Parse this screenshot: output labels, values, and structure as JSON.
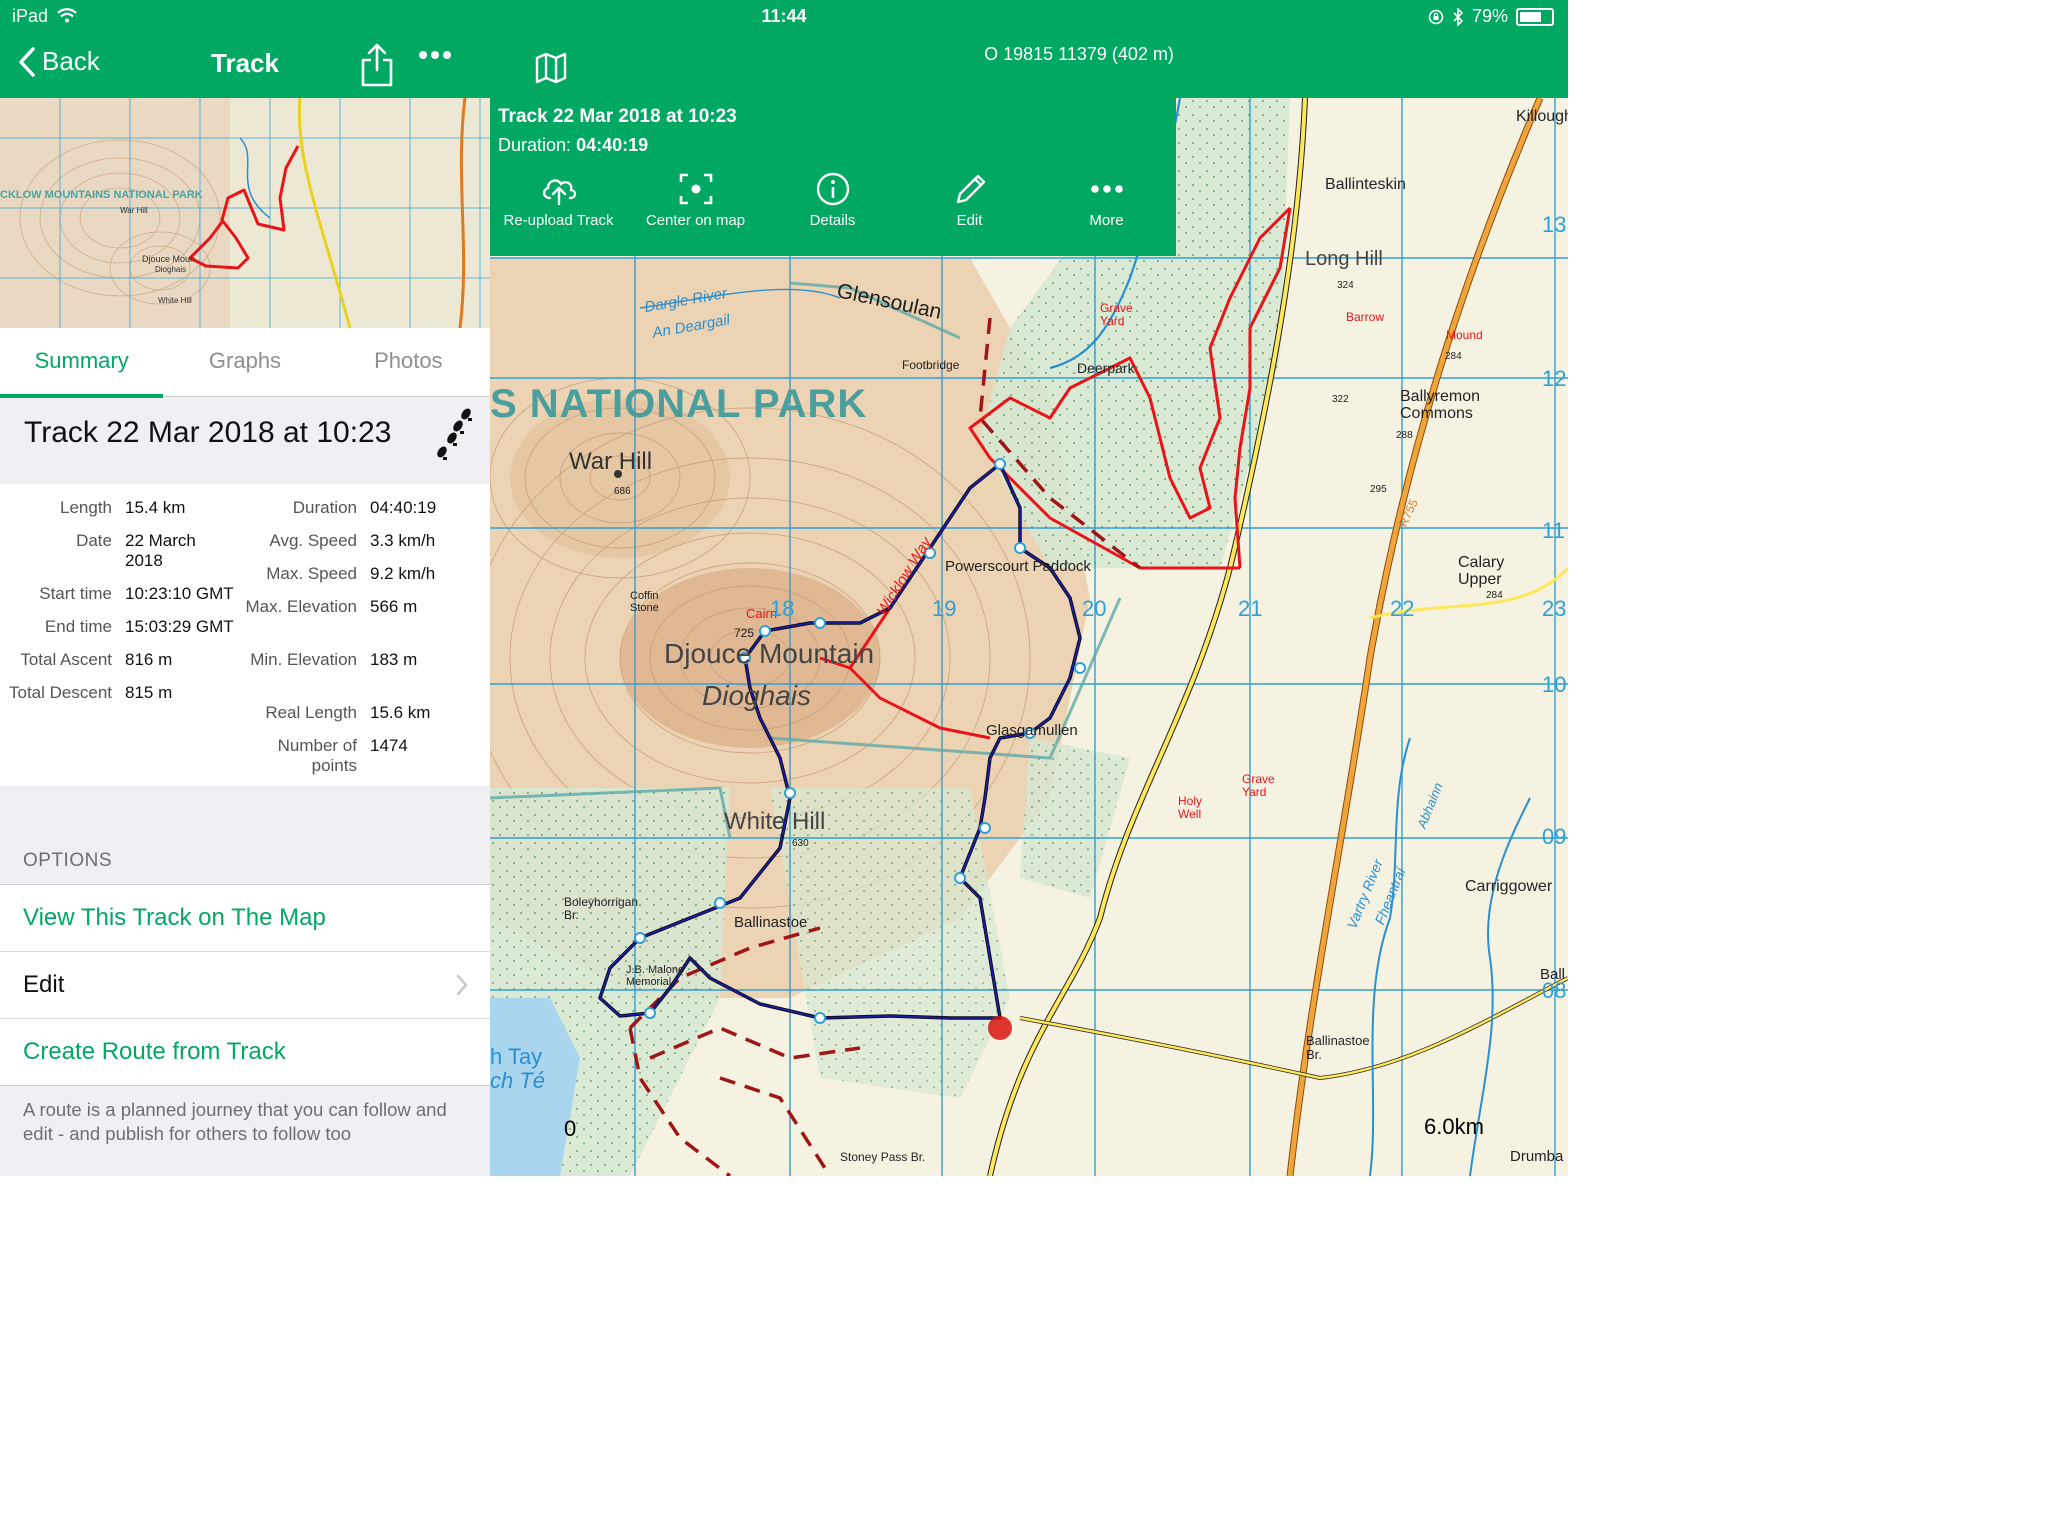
{
  "status": {
    "device": "iPad",
    "time": "11:44",
    "battery": "79%",
    "battery_level": 0.79
  },
  "nav": {
    "back_label": "Back",
    "title": "Track"
  },
  "map_header": {
    "coords": "O 19815 11379  (402 m)"
  },
  "popup": {
    "title": "Track 22 Mar 2018 at 10:23",
    "duration_label": "Duration:",
    "duration_value": "04:40:19",
    "actions": [
      "Re-upload Track",
      "Center on map",
      "Details",
      "Edit",
      "More"
    ]
  },
  "tabs": [
    "Summary",
    "Graphs",
    "Photos"
  ],
  "track_title": "Track 22 Mar 2018 at 10:23",
  "stats_left": [
    {
      "label": "Length",
      "value": "15.4 km"
    },
    {
      "label": "Date",
      "value": "22 March 2018"
    },
    {
      "label": "Start time",
      "value": "10:23:10 GMT"
    },
    {
      "label": "End time",
      "value": "15:03:29 GMT"
    },
    {
      "label": "Total Ascent",
      "value": "816 m"
    },
    {
      "label": "Total Descent",
      "value": "815 m"
    }
  ],
  "stats_right": [
    {
      "label": "Duration",
      "value": "04:40:19"
    },
    {
      "label": "Avg. Speed",
      "value": "3.3 km/h"
    },
    {
      "label": "Max. Speed",
      "value": "9.2 km/h"
    },
    {
      "label": "Max. Elevation",
      "value": "566 m"
    },
    {
      "label": "Min. Elevation",
      "value": "183 m"
    },
    {
      "label": "Real Length",
      "value": "15.6 km"
    },
    {
      "label": "Number of points",
      "value": "1474"
    }
  ],
  "options": {
    "header": "OPTIONS",
    "items": [
      "View This Track on The Map",
      "Edit",
      "Create Route from Track"
    ],
    "footnote": "A route is a planned journey that you can follow and edit - and publish for others to follow too"
  },
  "thumb_labels": [
    "CKLOW MOUNTAINS NATIONAL PARK",
    "War Hill",
    "Djouce Moun",
    "Dioghais",
    "White Hill"
  ],
  "map_labels": {
    "park": "S NATIONAL PARK",
    "war_hill": "War Hill",
    "djouce": "Djouce Mountain",
    "dioghais": "Dioghais",
    "white_hill": "White Hill",
    "glensoulan": "Glensoulan",
    "long_hill": "Long Hill",
    "ballinteskin": "Ballinteskin",
    "killough": "Killough",
    "ballyremon": "Ballyremon Commons",
    "calary": "Calary Upper",
    "carriggower": "Carriggower",
    "powerscourt": "Powerscourt Paddock",
    "glasgamullen": "Glasgamullen",
    "ballinastoe": "Ballinastoe",
    "boleyhorrigan": "Boleyhorrigan Br.",
    "malone": "J.B. Malone Memorial",
    "dargle": "Dargle River",
    "an_deargail": "An Deargail",
    "wicklow_way": "Wicklow Way",
    "cairn": "Cairn",
    "coffin_stone": "Coffin Stone",
    "footbridge": "Footbridge",
    "deerpark": "Deerpark",
    "grave_yard": "Grave Yard",
    "holy_well": "Holy Well",
    "barrow": "Barrow",
    "mound": "Mound",
    "vartry": "Vartry River",
    "fheantrai": "Fheantraí",
    "abhainn": "Abhainn",
    "tay": "h Tay",
    "te": "ch Té",
    "ballinastoe_br": "Ballinastoe Br.",
    "stoney_pass": "Stoney Pass Br.",
    "drumba": "Drumba",
    "ball": "Ball",
    "r755": "R755",
    "grid_numbers": [
      "18",
      "19",
      "20",
      "21",
      "22",
      "23",
      "13",
      "12",
      "11",
      "10",
      "09",
      "08"
    ],
    "spot_heights": [
      "686",
      "725",
      "630",
      "324",
      "322",
      "295",
      "288",
      "284",
      "284"
    ]
  },
  "scale": {
    "start": "0",
    "end": "6.0km"
  },
  "colors": {
    "accent": "#00a862",
    "track_blue": "#1a1aa8",
    "route_red": "#e8141a",
    "grid": "#2f9fd6"
  }
}
